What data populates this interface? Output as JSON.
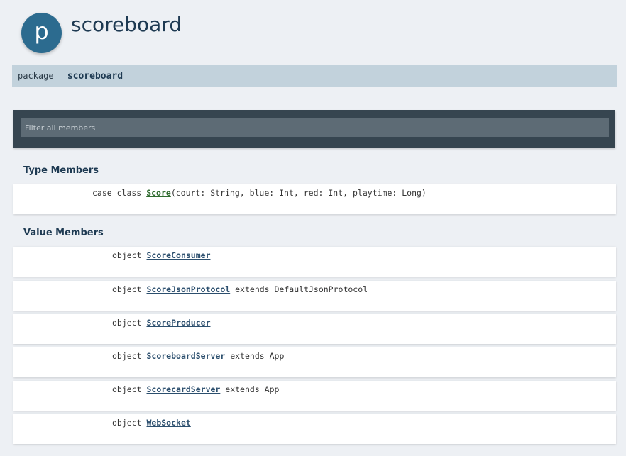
{
  "header": {
    "badge_letter": "p",
    "title": "scoreboard"
  },
  "signature": {
    "keyword": "package",
    "name": "scoreboard"
  },
  "filter": {
    "placeholder": "Filter all members"
  },
  "type_members": {
    "title": "Type Members",
    "items": [
      {
        "kind": "case class",
        "name": "Score",
        "params": "(court: String, blue: Int, red: Int, playtime: Long)"
      }
    ]
  },
  "value_members": {
    "title": "Value Members",
    "items": [
      {
        "kind": "object",
        "name": "ScoreConsumer",
        "extends": ""
      },
      {
        "kind": "object",
        "name": "ScoreJsonProtocol",
        "extends": "extends DefaultJsonProtocol"
      },
      {
        "kind": "object",
        "name": "ScoreProducer",
        "extends": ""
      },
      {
        "kind": "object",
        "name": "ScoreboardServer",
        "extends": "extends App"
      },
      {
        "kind": "object",
        "name": "ScorecardServer",
        "extends": "extends App"
      },
      {
        "kind": "object",
        "name": "WebSocket",
        "extends": ""
      }
    ]
  }
}
